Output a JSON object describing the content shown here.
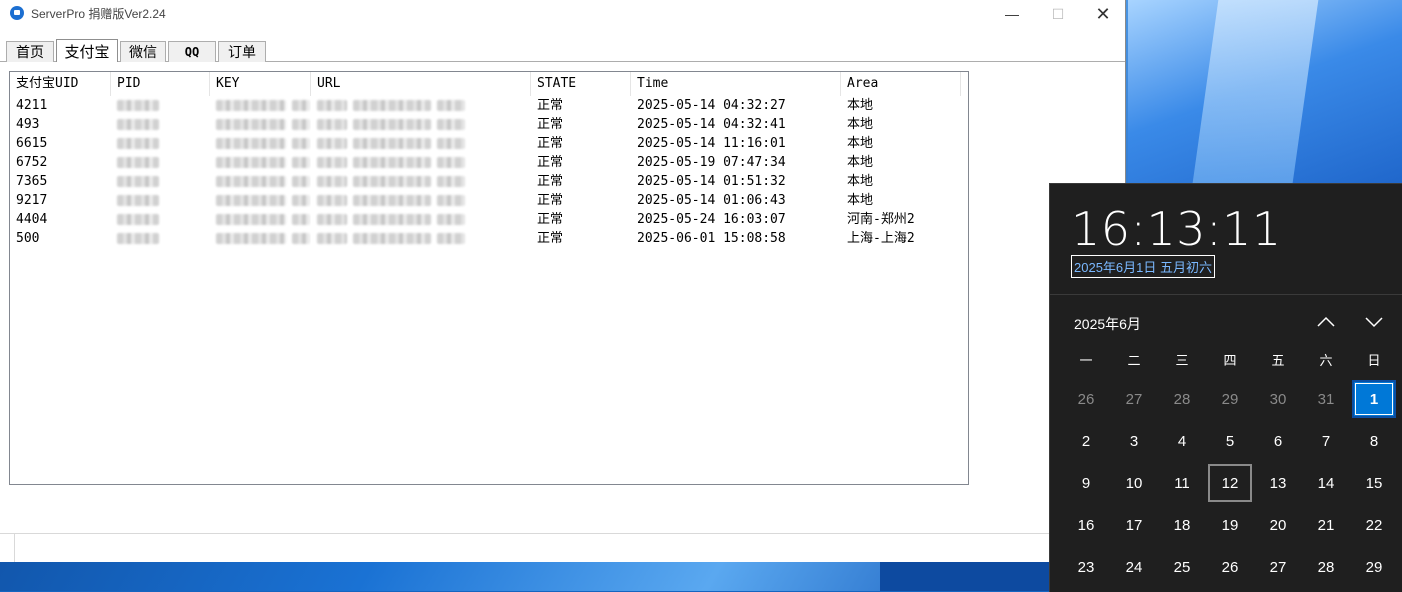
{
  "window": {
    "title": "ServerPro 捐赠版Ver2.24",
    "controls": {
      "minimize": "—",
      "maximize": "☐",
      "close": "✕"
    }
  },
  "tabs": [
    {
      "label": "首页",
      "active": false
    },
    {
      "label": "支付宝",
      "active": true
    },
    {
      "label": "微信",
      "active": false
    },
    {
      "label": "QQ",
      "active": false
    },
    {
      "label": "订单",
      "active": false
    }
  ],
  "table": {
    "columns": [
      "支付宝UID",
      "PID",
      "KEY",
      "URL",
      "STATE",
      "Time",
      "Area"
    ],
    "rows": [
      {
        "uid": "4211",
        "state": "正常",
        "time": "2025-05-14 04:32:27",
        "area": "本地"
      },
      {
        "uid": "493",
        "state": "正常",
        "time": "2025-05-14 04:32:41",
        "area": "本地"
      },
      {
        "uid": "6615",
        "state": "正常",
        "time": "2025-05-14 11:16:01",
        "area": "本地"
      },
      {
        "uid": "6752",
        "state": "正常",
        "time": "2025-05-19 07:47:34",
        "area": "本地"
      },
      {
        "uid": "7365",
        "state": "正常",
        "time": "2025-05-14 01:51:32",
        "area": "本地"
      },
      {
        "uid": "9217",
        "state": "正常",
        "time": "2025-05-14 01:06:43",
        "area": "本地"
      },
      {
        "uid": "4404",
        "state": "正常",
        "time": "2025-05-24 16:03:07",
        "area": "河南-郑州2"
      },
      {
        "uid": "500",
        "state": "正常",
        "time": "2025-06-01 15:08:58",
        "area": "上海-上海2"
      }
    ]
  },
  "flyout": {
    "time": "16:13:11",
    "date_text": "2025年6月1日 五月初六",
    "month_title": "2025年6月",
    "weekdays": [
      "一",
      "二",
      "三",
      "四",
      "五",
      "六",
      "日"
    ],
    "days": [
      {
        "d": "26",
        "muted": true
      },
      {
        "d": "27",
        "muted": true
      },
      {
        "d": "28",
        "muted": true
      },
      {
        "d": "29",
        "muted": true
      },
      {
        "d": "30",
        "muted": true
      },
      {
        "d": "31",
        "muted": true
      },
      {
        "d": "1",
        "today": true
      },
      {
        "d": "2"
      },
      {
        "d": "3"
      },
      {
        "d": "4"
      },
      {
        "d": "5"
      },
      {
        "d": "6"
      },
      {
        "d": "7"
      },
      {
        "d": "8"
      },
      {
        "d": "9"
      },
      {
        "d": "10"
      },
      {
        "d": "11"
      },
      {
        "d": "12",
        "selected": true
      },
      {
        "d": "13"
      },
      {
        "d": "14"
      },
      {
        "d": "15"
      },
      {
        "d": "16"
      },
      {
        "d": "17"
      },
      {
        "d": "18"
      },
      {
        "d": "19"
      },
      {
        "d": "20"
      },
      {
        "d": "21"
      },
      {
        "d": "22"
      },
      {
        "d": "23"
      },
      {
        "d": "24"
      },
      {
        "d": "25"
      },
      {
        "d": "26"
      },
      {
        "d": "27"
      },
      {
        "d": "28"
      },
      {
        "d": "29"
      }
    ],
    "colors": {
      "accent": "#0078d7",
      "date_link": "#7ab8ff",
      "background": "#1f1f1f"
    }
  }
}
